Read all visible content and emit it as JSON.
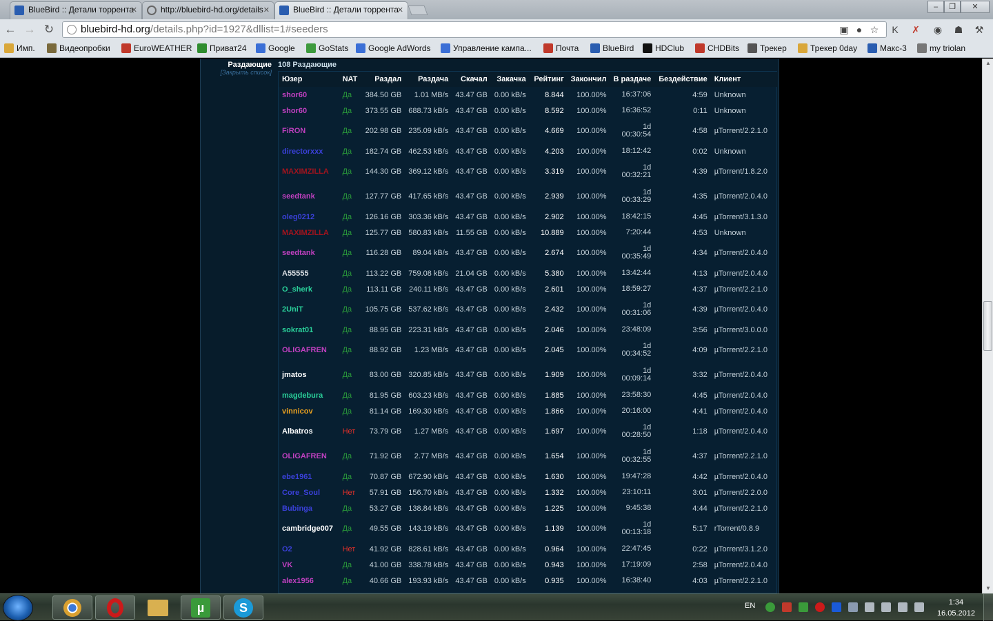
{
  "browser": {
    "tabs": [
      {
        "title": "BlueBird :: Детали торрента",
        "icon": "bluebird-favicon",
        "active": false
      },
      {
        "title": "http://bluebird-hd.org/details",
        "icon": "globe-icon",
        "active": false
      },
      {
        "title": "BlueBird :: Детали торрента",
        "icon": "bluebird-favicon",
        "active": true
      }
    ],
    "url_host": "bluebird-hd.org",
    "url_path": "/details.php?id=1927&dllist=1#seeders"
  },
  "bookmarks": [
    {
      "label": "Имп.",
      "icon": "folder-icon",
      "color": "#d9a73a"
    },
    {
      "label": "Видеопробки",
      "icon": "traffic-icon",
      "color": "#7a6a3c"
    },
    {
      "label": "EuroWEATHER",
      "icon": "weather-icon",
      "color": "#c0392b"
    },
    {
      "label": "Приват24",
      "icon": "privat24-icon",
      "color": "#2f8d2f"
    },
    {
      "label": "Google",
      "icon": "google-icon",
      "color": "#3b6fd6"
    },
    {
      "label": "GoStats",
      "icon": "gostats-icon",
      "color": "#3d9a3d"
    },
    {
      "label": "Google AdWords",
      "icon": "adwords-icon",
      "color": "#3b6fd6"
    },
    {
      "label": "Управление кампа...",
      "icon": "adwords-icon",
      "color": "#3b6fd6"
    },
    {
      "label": "Почта",
      "icon": "mail-icon",
      "color": "#c0392b"
    },
    {
      "label": "BlueBird",
      "icon": "bluebird-favicon",
      "color": "#2a5db0"
    },
    {
      "label": "HDClub",
      "icon": "hdclub-icon",
      "color": "#111111"
    },
    {
      "label": "CHDBits",
      "icon": "chdbits-icon",
      "color": "#c0392b"
    },
    {
      "label": "Трекер",
      "icon": "tracker-icon",
      "color": "#555555"
    },
    {
      "label": "Трекер 0day",
      "icon": "tracker-icon",
      "color": "#d9a73a"
    },
    {
      "label": "Макс-3",
      "icon": "maks-icon",
      "color": "#2a5db0"
    },
    {
      "label": "my triolan",
      "icon": "globe-icon",
      "color": "#777777"
    }
  ],
  "section": {
    "label": "Раздающие",
    "close_link": "[Закрыть список]",
    "count": "108 Раздающие"
  },
  "columns": [
    "Юзер",
    "NAT",
    "Раздал",
    "Раздача",
    "Скачал",
    "Закачка",
    "Рейтинг",
    "Закончил",
    "В раздаче",
    "Бездействие",
    "Клиент"
  ],
  "seeders": [
    {
      "user": "shor60",
      "color": "#c040c0",
      "nat": "Да",
      "uploaded": "384.50 GB",
      "up_speed": "1.01 MB/s",
      "downloaded": "43.47 GB",
      "down_speed": "0.00 kB/s",
      "ratio": "8.844",
      "done": "100.00%",
      "seeding": "16:37:06",
      "idle": "4:59",
      "client": "Unknown"
    },
    {
      "user": "shor60",
      "color": "#c040c0",
      "nat": "Да",
      "uploaded": "373.55 GB",
      "up_speed": "688.73 kB/s",
      "downloaded": "43.47 GB",
      "down_speed": "0.00 kB/s",
      "ratio": "8.592",
      "done": "100.00%",
      "seeding": "16:36:52",
      "idle": "0:11",
      "client": "Unknown"
    },
    {
      "user": "FiRON",
      "color": "#c040c0",
      "nat": "Да",
      "uploaded": "202.98 GB",
      "up_speed": "235.09 kB/s",
      "downloaded": "43.47 GB",
      "down_speed": "0.00 kB/s",
      "ratio": "4.669",
      "done": "100.00%",
      "seeding_days": "1d",
      "seeding": "00:30:54",
      "idle": "4:58",
      "client": "µTorrent/2.2.1.0"
    },
    {
      "user": "directorxxx",
      "color": "#3a40d8",
      "nat": "Да",
      "uploaded": "182.74 GB",
      "up_speed": "462.53 kB/s",
      "downloaded": "43.47 GB",
      "down_speed": "0.00 kB/s",
      "ratio": "4.203",
      "done": "100.00%",
      "seeding": "18:12:42",
      "idle": "0:02",
      "client": "Unknown"
    },
    {
      "user": "MAXIMZILLA",
      "color": "#a0141e",
      "nat": "Да",
      "uploaded": "144.30 GB",
      "up_speed": "369.12 kB/s",
      "downloaded": "43.47 GB",
      "down_speed": "0.00 kB/s",
      "ratio": "3.319",
      "done": "100.00%",
      "seeding_days": "1d",
      "seeding": "00:32:21",
      "idle": "4:39",
      "client": "µTorrent/1.8.2.0"
    },
    {
      "user": "seedtank",
      "color": "#c040c0",
      "nat": "Да",
      "uploaded": "127.77 GB",
      "up_speed": "417.65 kB/s",
      "downloaded": "43.47 GB",
      "down_speed": "0.00 kB/s",
      "ratio": "2.939",
      "done": "100.00%",
      "seeding_days": "1d",
      "seeding": "00:33:29",
      "idle": "4:35",
      "client": "µTorrent/2.0.4.0"
    },
    {
      "user": "oleg0212",
      "color": "#3a40d8",
      "nat": "Да",
      "uploaded": "126.16 GB",
      "up_speed": "303.36 kB/s",
      "downloaded": "43.47 GB",
      "down_speed": "0.00 kB/s",
      "ratio": "2.902",
      "done": "100.00%",
      "seeding": "18:42:15",
      "idle": "4:45",
      "client": "µTorrent/3.1.3.0"
    },
    {
      "user": "MAXIMZILLA",
      "color": "#a0141e",
      "nat": "Да",
      "uploaded": "125.77 GB",
      "up_speed": "580.83 kB/s",
      "downloaded": "11.55 GB",
      "down_speed": "0.00 kB/s",
      "ratio": "10.889",
      "done": "100.00%",
      "seeding": "7:20:44",
      "idle": "4:53",
      "client": "Unknown"
    },
    {
      "user": "seedtank",
      "color": "#c040c0",
      "nat": "Да",
      "uploaded": "116.28 GB",
      "up_speed": "89.04 kB/s",
      "downloaded": "43.47 GB",
      "down_speed": "0.00 kB/s",
      "ratio": "2.674",
      "done": "100.00%",
      "seeding_days": "1d",
      "seeding": "00:35:49",
      "idle": "4:34",
      "client": "µTorrent/2.0.4.0"
    },
    {
      "user": "A55555",
      "color": "#d8dde2",
      "nat": "Да",
      "uploaded": "113.22 GB",
      "up_speed": "759.08 kB/s",
      "downloaded": "21.04 GB",
      "down_speed": "0.00 kB/s",
      "ratio": "5.380",
      "done": "100.00%",
      "seeding": "13:42:44",
      "idle": "4:13",
      "client": "µTorrent/2.0.4.0"
    },
    {
      "user": "O_sherk",
      "color": "#2ad09a",
      "nat": "Да",
      "uploaded": "113.11 GB",
      "up_speed": "240.11 kB/s",
      "downloaded": "43.47 GB",
      "down_speed": "0.00 kB/s",
      "ratio": "2.601",
      "done": "100.00%",
      "seeding": "18:59:27",
      "idle": "4:37",
      "client": "µTorrent/2.2.1.0"
    },
    {
      "user": "2UniT",
      "color": "#2ad09a",
      "nat": "Да",
      "uploaded": "105.75 GB",
      "up_speed": "537.62 kB/s",
      "downloaded": "43.47 GB",
      "down_speed": "0.00 kB/s",
      "ratio": "2.432",
      "done": "100.00%",
      "seeding_days": "1d",
      "seeding": "00:31:06",
      "idle": "4:39",
      "client": "µTorrent/2.0.4.0"
    },
    {
      "user": "sokrat01",
      "color": "#2ad09a",
      "nat": "Да",
      "uploaded": "88.95 GB",
      "up_speed": "223.31 kB/s",
      "downloaded": "43.47 GB",
      "down_speed": "0.00 kB/s",
      "ratio": "2.046",
      "done": "100.00%",
      "seeding": "23:48:09",
      "idle": "3:56",
      "client": "µTorrent/3.0.0.0"
    },
    {
      "user": "OLIGAFREN",
      "color": "#c040c0",
      "nat": "Да",
      "uploaded": "88.92 GB",
      "up_speed": "1.23 MB/s",
      "downloaded": "43.47 GB",
      "down_speed": "0.00 kB/s",
      "ratio": "2.045",
      "done": "100.00%",
      "seeding_days": "1d",
      "seeding": "00:34:52",
      "idle": "4:09",
      "client": "µTorrent/2.2.1.0"
    },
    {
      "user": "jmatos",
      "color": "#ffffff",
      "nat": "Да",
      "uploaded": "83.00 GB",
      "up_speed": "320.85 kB/s",
      "downloaded": "43.47 GB",
      "down_speed": "0.00 kB/s",
      "ratio": "1.909",
      "done": "100.00%",
      "seeding_days": "1d",
      "seeding": "00:09:14",
      "idle": "3:32",
      "client": "µTorrent/2.0.4.0"
    },
    {
      "user": "magdebura",
      "color": "#2ad09a",
      "nat": "Да",
      "uploaded": "81.95 GB",
      "up_speed": "603.23 kB/s",
      "downloaded": "43.47 GB",
      "down_speed": "0.00 kB/s",
      "ratio": "1.885",
      "done": "100.00%",
      "seeding": "23:58:30",
      "idle": "4:45",
      "client": "µTorrent/2.0.4.0"
    },
    {
      "user": "vinnicov",
      "color": "#e8a020",
      "nat": "Да",
      "uploaded": "81.14 GB",
      "up_speed": "169.30 kB/s",
      "downloaded": "43.47 GB",
      "down_speed": "0.00 kB/s",
      "ratio": "1.866",
      "done": "100.00%",
      "seeding": "20:16:00",
      "idle": "4:41",
      "client": "µTorrent/2.0.4.0"
    },
    {
      "user": "Albatros",
      "color": "#ffffff",
      "nat": "Нет",
      "uploaded": "73.79 GB",
      "up_speed": "1.27 MB/s",
      "downloaded": "43.47 GB",
      "down_speed": "0.00 kB/s",
      "ratio": "1.697",
      "done": "100.00%",
      "seeding_days": "1d",
      "seeding": "00:28:50",
      "idle": "1:18",
      "client": "µTorrent/2.0.4.0"
    },
    {
      "user": "OLIGAFREN",
      "color": "#c040c0",
      "nat": "Да",
      "uploaded": "71.92 GB",
      "up_speed": "2.77 MB/s",
      "downloaded": "43.47 GB",
      "down_speed": "0.00 kB/s",
      "ratio": "1.654",
      "done": "100.00%",
      "seeding_days": "1d",
      "seeding": "00:32:55",
      "idle": "4:37",
      "client": "µTorrent/2.2.1.0"
    },
    {
      "user": "ebe1961",
      "color": "#3a40d8",
      "nat": "Да",
      "uploaded": "70.87 GB",
      "up_speed": "672.90 kB/s",
      "downloaded": "43.47 GB",
      "down_speed": "0.00 kB/s",
      "ratio": "1.630",
      "done": "100.00%",
      "seeding": "19:47:28",
      "idle": "4:42",
      "client": "µTorrent/2.0.4.0"
    },
    {
      "user": "Core_Soul",
      "color": "#3a40d8",
      "nat": "Нет",
      "uploaded": "57.91 GB",
      "up_speed": "156.70 kB/s",
      "downloaded": "43.47 GB",
      "down_speed": "0.00 kB/s",
      "ratio": "1.332",
      "done": "100.00%",
      "seeding": "23:10:11",
      "idle": "3:01",
      "client": "µTorrent/2.2.0.0"
    },
    {
      "user": "Bubinga",
      "color": "#3a40d8",
      "nat": "Да",
      "uploaded": "53.27 GB",
      "up_speed": "138.84 kB/s",
      "downloaded": "43.47 GB",
      "down_speed": "0.00 kB/s",
      "ratio": "1.225",
      "done": "100.00%",
      "seeding": "9:45:38",
      "idle": "4:44",
      "client": "µTorrent/2.2.1.0"
    },
    {
      "user": "cambridge007",
      "color": "#ffffff",
      "nat": "Да",
      "uploaded": "49.55 GB",
      "up_speed": "143.19 kB/s",
      "downloaded": "43.47 GB",
      "down_speed": "0.00 kB/s",
      "ratio": "1.139",
      "done": "100.00%",
      "seeding_days": "1d",
      "seeding": "00:13:18",
      "idle": "5:17",
      "client": "rTorrent/0.8.9"
    },
    {
      "user": "O2",
      "color": "#3a40d8",
      "nat": "Нет",
      "uploaded": "41.92 GB",
      "up_speed": "828.61 kB/s",
      "downloaded": "43.47 GB",
      "down_speed": "0.00 kB/s",
      "ratio": "0.964",
      "done": "100.00%",
      "seeding": "22:47:45",
      "idle": "0:22",
      "client": "µTorrent/3.1.2.0"
    },
    {
      "user": "VK",
      "color": "#c040c0",
      "nat": "Да",
      "uploaded": "41.00 GB",
      "up_speed": "338.78 kB/s",
      "downloaded": "43.47 GB",
      "down_speed": "0.00 kB/s",
      "ratio": "0.943",
      "done": "100.00%",
      "seeding": "17:19:09",
      "idle": "2:58",
      "client": "µTorrent/2.0.4.0"
    },
    {
      "user": "alex1956",
      "color": "#c040c0",
      "nat": "Да",
      "uploaded": "40.66 GB",
      "up_speed": "193.93 kB/s",
      "downloaded": "43.47 GB",
      "down_speed": "0.00 kB/s",
      "ratio": "0.935",
      "done": "100.00%",
      "seeding": "16:38:40",
      "idle": "4:03",
      "client": "µTorrent/2.2.1.0"
    }
  ],
  "colors": {
    "nat_yes": "#2a9a3a",
    "nat_no": "#e0302a"
  },
  "taskbar": {
    "apps": [
      {
        "name": "chrome-icon",
        "color": "#d9a030"
      },
      {
        "name": "opera-icon",
        "color": "#cc1a1a"
      },
      {
        "name": "explorer-icon",
        "color": "#d9b050"
      },
      {
        "name": "utorrent-icon",
        "color": "#3a9a3a"
      },
      {
        "name": "skype-icon",
        "color": "#1a9ad8"
      }
    ],
    "language": "EN",
    "time": "1:34",
    "date": "16.05.2012"
  }
}
